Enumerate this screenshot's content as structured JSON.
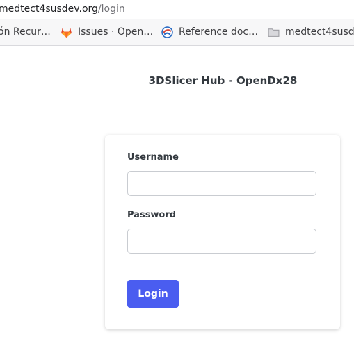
{
  "browser": {
    "url_host": "medtect4susdev.org",
    "url_path": "/login",
    "bookmarks": [
      {
        "label": "ón Recur…",
        "icon": "none"
      },
      {
        "label": "Issues · Open…",
        "icon": "gitlab-icon"
      },
      {
        "label": "Reference doc…",
        "icon": "slicer-icon"
      },
      {
        "label": "medtect4susd",
        "icon": "folder-icon"
      }
    ]
  },
  "page": {
    "title": "3DSlicer Hub - OpenDx28"
  },
  "login_form": {
    "username_label": "Username",
    "username_value": "",
    "password_label": "Password",
    "password_value": "",
    "submit_label": "Login"
  },
  "colors": {
    "button": "#4a5df0",
    "title": "#343a40"
  }
}
